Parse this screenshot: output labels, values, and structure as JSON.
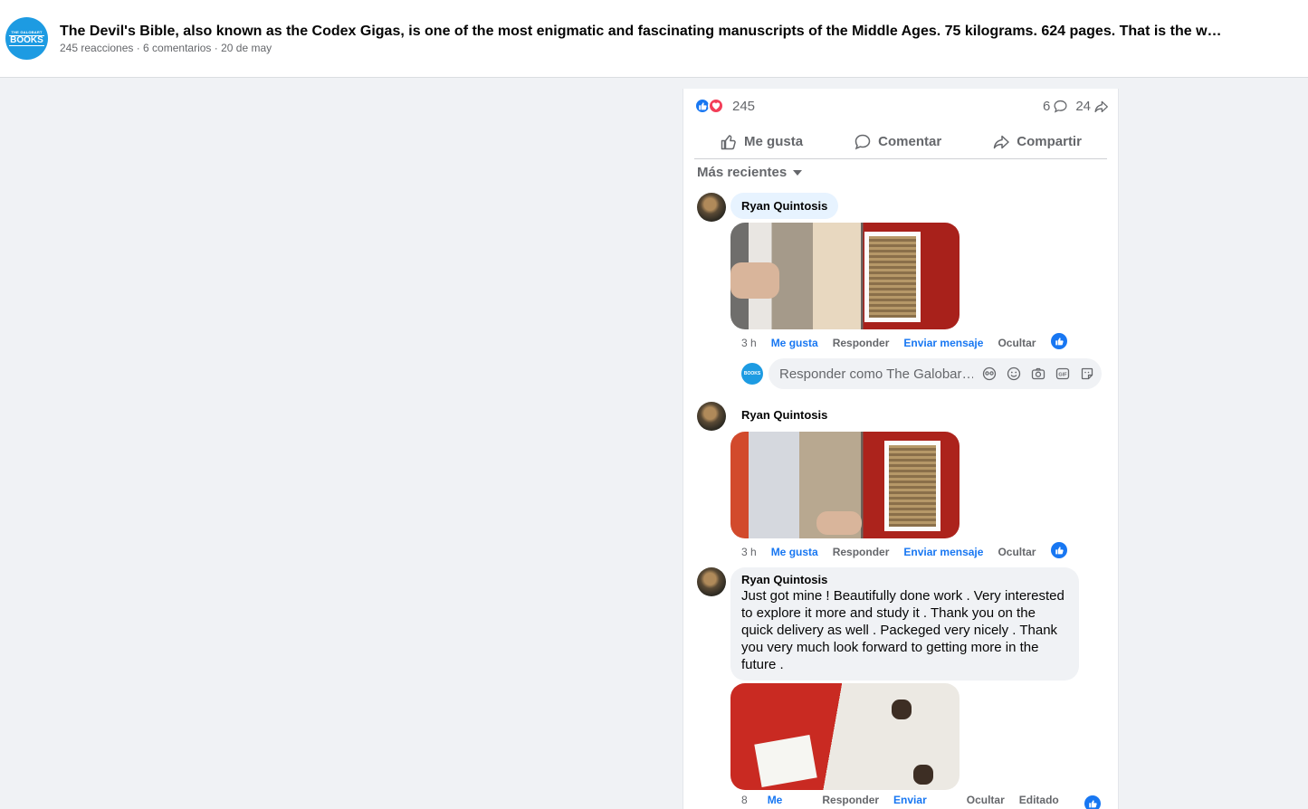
{
  "header": {
    "logo_line1": "THE GALOBART",
    "logo_line2": "BOOKS",
    "title": "The Devil's Bible, also known as the Codex Gigas, is one of the most enigmatic and fascinating manuscripts of the Middle Ages. 75 kilograms. 624 pages. That is the weight o…",
    "meta": "245 reacciones · 6 comentarios · 20 de may"
  },
  "stats": {
    "reactions": "245",
    "comments": "6",
    "shares": "24"
  },
  "actions": {
    "like": "Me gusta",
    "comment": "Comentar",
    "share": "Compartir"
  },
  "sort": {
    "label": "Más recientes"
  },
  "comments": [
    {
      "author": "Ryan Quintosis",
      "time": "3 h",
      "like": "Me gusta",
      "reply": "Responder",
      "message": "Enviar mensaje",
      "hide": "Ocultar"
    },
    {
      "author": "Ryan Quintosis",
      "time": "3 h",
      "like": "Me gusta",
      "reply": "Responder",
      "message": "Enviar mensaje",
      "hide": "Ocultar"
    },
    {
      "author": "Ryan Quintosis",
      "text": "Just got mine ! Beautifully done work . Very interested to explore it more and study it . Thank you on the quick delivery as well . Packeged very nicely . Thank you very much look forward to getting more in the future .",
      "time": "8",
      "like": "Me",
      "reply": "Responder",
      "message": "Enviar",
      "hide": "Ocultar",
      "edited": "Editado"
    }
  ],
  "reply_box": {
    "avatar_text": "BOOKS",
    "placeholder": "Responder como The Galobar…"
  },
  "icons": [
    "like-icon",
    "love-icon",
    "comment-icon",
    "share-icon",
    "chevron-down-icon",
    "avatar-icon",
    "sticker-icon",
    "emoji-icon",
    "camera-icon",
    "gif-icon",
    "sticker-face-icon"
  ],
  "colors": {
    "accent": "#1877f2",
    "love": "#f33e58",
    "brand": "#1d9be2",
    "background": "#f0f2f5"
  }
}
